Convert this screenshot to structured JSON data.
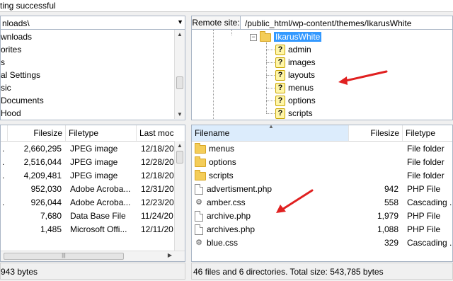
{
  "status": {
    "message": "ting successful"
  },
  "local": {
    "path": "nloads\\",
    "tree_items": [
      "wnloads",
      "orites",
      "s",
      "al Settings",
      "sic",
      "Documents",
      "Hood"
    ],
    "list": {
      "columns": [
        "Filesize",
        "Filetype",
        "Last moc"
      ],
      "rows": [
        {
          "name": ".",
          "size": "2,660,295",
          "type": "JPEG image",
          "date": "12/18/20"
        },
        {
          "name": ".",
          "size": "2,516,044",
          "type": "JPEG image",
          "date": "12/28/20"
        },
        {
          "name": ".",
          "size": "4,209,481",
          "type": "JPEG image",
          "date": "12/18/20"
        },
        {
          "name": "",
          "size": "952,030",
          "type": "Adobe Acroba...",
          "date": "12/31/20"
        },
        {
          "name": ".",
          "size": "926,044",
          "type": "Adobe Acroba...",
          "date": "12/23/20"
        },
        {
          "name": "",
          "size": "7,680",
          "type": "Data Base File",
          "date": "11/24/20"
        },
        {
          "name": "",
          "size": "1,485",
          "type": "Microsoft Offi...",
          "date": "12/11/20"
        }
      ]
    },
    "summary": "943 bytes"
  },
  "remote": {
    "label": "Remote site:",
    "path": "/public_html/wp-content/themes/IkarusWhite",
    "tree": {
      "root": "IkarusWhite",
      "children": [
        "admin",
        "images",
        "layouts",
        "menus",
        "options",
        "scripts"
      ]
    },
    "list": {
      "columns": [
        "Filename",
        "Filesize",
        "Filetype"
      ],
      "rows": [
        {
          "name": "menus",
          "size": "",
          "type": "File folder",
          "icon": "folder-icon"
        },
        {
          "name": "options",
          "size": "",
          "type": "File folder",
          "icon": "folder-icon"
        },
        {
          "name": "scripts",
          "size": "",
          "type": "File folder",
          "icon": "folder-icon"
        },
        {
          "name": "advertisment.php",
          "size": "942",
          "type": "PHP File",
          "icon": "file-icon"
        },
        {
          "name": "amber.css",
          "size": "558",
          "type": "Cascading ...",
          "icon": "css-file-icon"
        },
        {
          "name": "archive.php",
          "size": "1,979",
          "type": "PHP File",
          "icon": "file-icon"
        },
        {
          "name": "archives.php",
          "size": "1,088",
          "type": "PHP File",
          "icon": "file-icon"
        },
        {
          "name": "blue.css",
          "size": "329",
          "type": "Cascading ...",
          "icon": "css-file-icon"
        }
      ]
    },
    "summary": "46 files and 6 directories. Total size: 543,785 bytes"
  },
  "colors": {
    "selection": "#3399ff",
    "annotation_arrow": "#e02020",
    "sorted_header": "#dcecfc"
  }
}
